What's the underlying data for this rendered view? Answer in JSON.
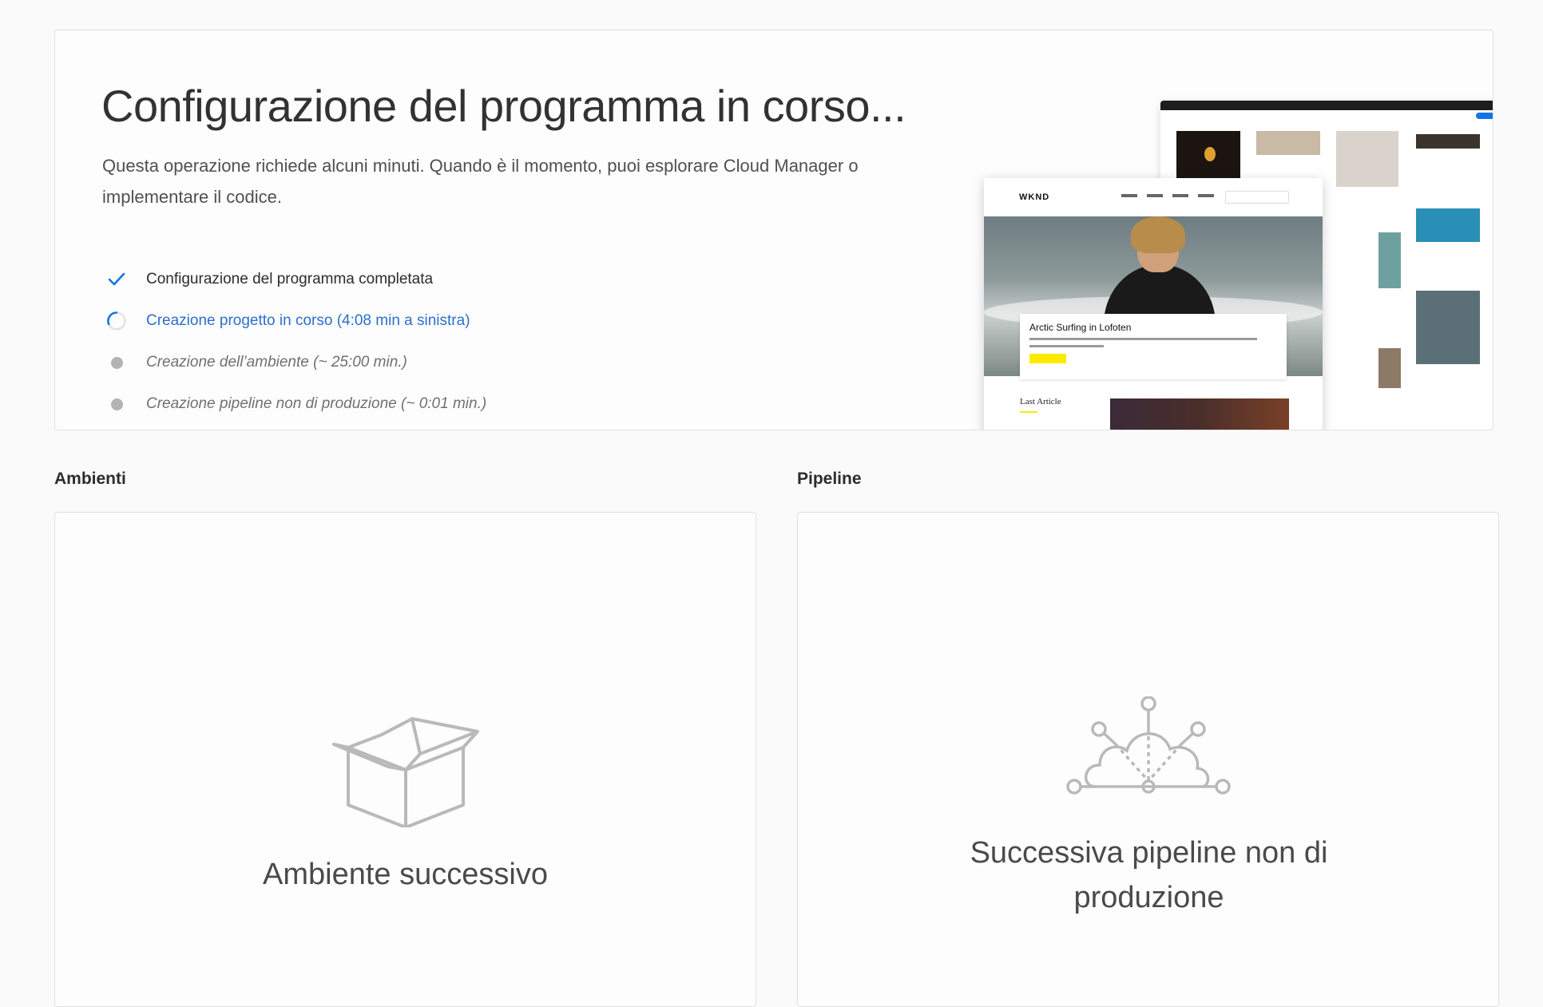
{
  "hero": {
    "title": "Configurazione del programma in corso...",
    "description": "Questa operazione richiede alcuni minuti. Quando è il momento, puoi esplorare Cloud Manager o implementare il codice.",
    "steps": [
      {
        "label": "Configurazione del programma completata",
        "status": "done",
        "icon": "checkmark-icon"
      },
      {
        "label": "Creazione progetto in corso (4:08 min a sinistra)",
        "status": "in-progress",
        "icon": "spinner-icon"
      },
      {
        "label": "Creazione dell’ambiente (~ 25:00 min.)",
        "status": "pending",
        "icon": "dot-icon"
      },
      {
        "label": "Creazione pipeline non di produzione (~ 0:01 min.)",
        "status": "pending",
        "icon": "dot-icon"
      }
    ],
    "preview": {
      "site_logo": "WKND",
      "card_title": "Arctic Surfing in Lofoten",
      "section_title": "Last Article"
    }
  },
  "sections": {
    "environments": {
      "label": "Ambienti",
      "placeholder_text": "Ambiente successivo",
      "icon": "open-box-icon"
    },
    "pipelines": {
      "label": "Pipeline",
      "placeholder_text": "Successiva pipeline non di produzione",
      "icon": "cloud-network-icon"
    }
  },
  "colors": {
    "accent_blue": "#2b6fce",
    "check_blue": "#1473e6",
    "pending_dot": "#b3b3b3",
    "icon_gray": "#b9b9b9"
  }
}
